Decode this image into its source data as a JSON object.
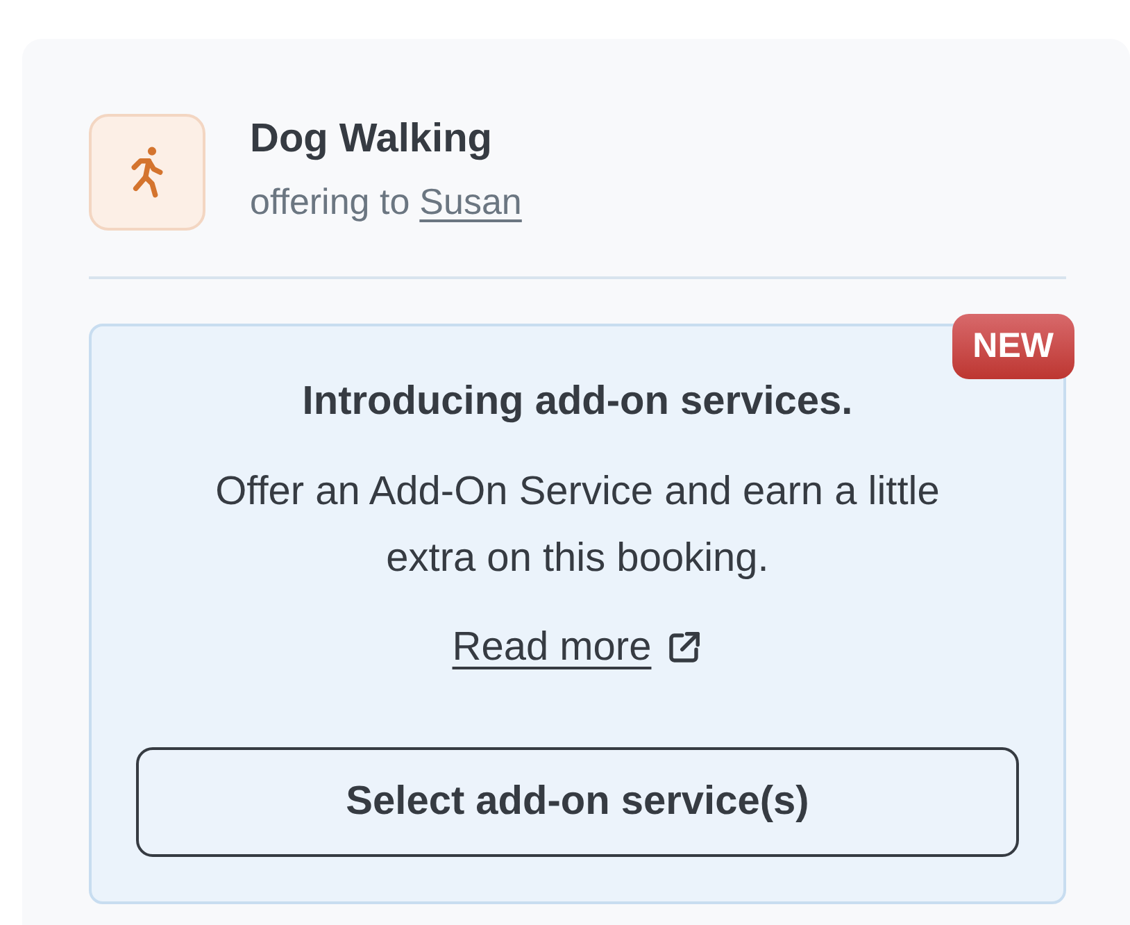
{
  "service": {
    "title": "Dog Walking",
    "subtitle": "offering to",
    "client": "Susan"
  },
  "promo": {
    "badge": "NEW",
    "heading": "Introducing add-on services.",
    "body": "Offer an Add-On Service and earn a little extra on this booking.",
    "link": "Read more",
    "button": "Select add-on service(s)"
  }
}
